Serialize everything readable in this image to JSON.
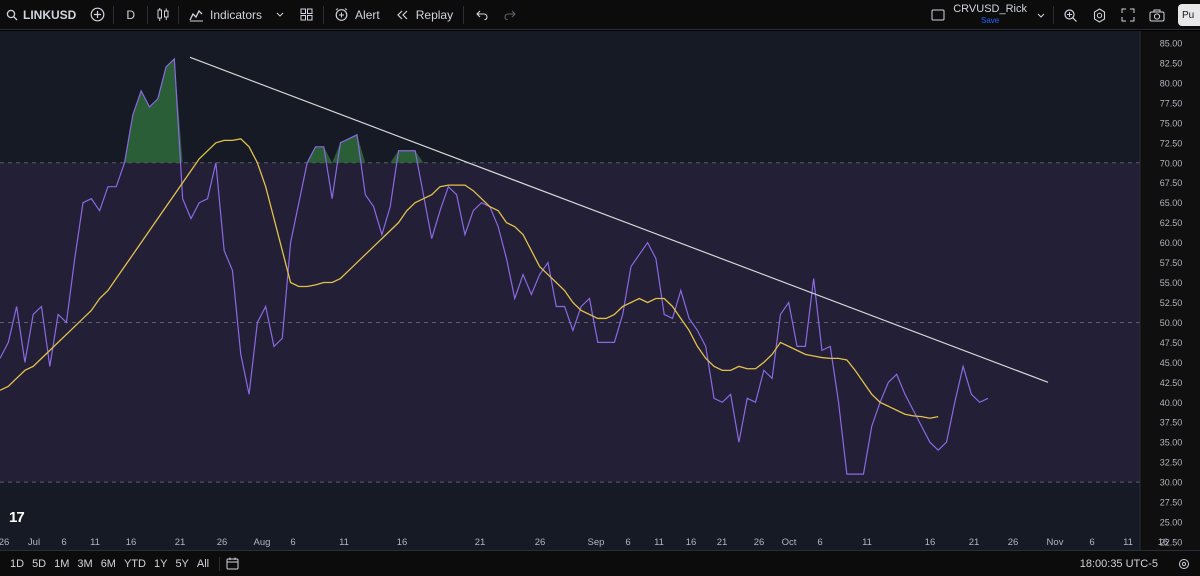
{
  "toolbar": {
    "symbol": "LINKUSD",
    "interval": "D",
    "indicators_label": "Indicators",
    "alert_label": "Alert",
    "replay_label": "Replay",
    "layout_name": "CRVUSD_Rick",
    "save_label": "Save",
    "publish_label": "Pu"
  },
  "bottom": {
    "ranges": [
      "1D",
      "5D",
      "1M",
      "3M",
      "6M",
      "YTD",
      "1Y",
      "5Y",
      "All"
    ],
    "clock": "18:00:35 UTC-5"
  },
  "chart": {
    "logo": "17",
    "price_axis_labels": [
      "85.00",
      "82.50",
      "80.00",
      "77.50",
      "75.00",
      "72.50",
      "70.00",
      "67.50",
      "65.00",
      "62.50",
      "60.00",
      "57.50",
      "55.00",
      "52.50",
      "50.00",
      "47.50",
      "45.00",
      "42.50",
      "40.00",
      "37.50",
      "35.00",
      "32.50",
      "30.00",
      "27.50",
      "25.00",
      "22.50"
    ],
    "time_axis": [
      {
        "label": "26",
        "x": 4
      },
      {
        "label": "Jul",
        "x": 34
      },
      {
        "label": "6",
        "x": 64
      },
      {
        "label": "11",
        "x": 95
      },
      {
        "label": "16",
        "x": 131
      },
      {
        "label": "21",
        "x": 180
      },
      {
        "label": "26",
        "x": 222
      },
      {
        "label": "Aug",
        "x": 262
      },
      {
        "label": "6",
        "x": 293
      },
      {
        "label": "11",
        "x": 344
      },
      {
        "label": "16",
        "x": 402
      },
      {
        "label": "21",
        "x": 480
      },
      {
        "label": "26",
        "x": 540
      },
      {
        "label": "Sep",
        "x": 596
      },
      {
        "label": "6",
        "x": 628
      },
      {
        "label": "11",
        "x": 659
      },
      {
        "label": "16",
        "x": 691
      },
      {
        "label": "21",
        "x": 722
      },
      {
        "label": "26",
        "x": 759
      },
      {
        "label": "Oct",
        "x": 789
      },
      {
        "label": "6",
        "x": 820
      },
      {
        "label": "11",
        "x": 867
      },
      {
        "label": "16",
        "x": 930
      },
      {
        "label": "21",
        "x": 974
      },
      {
        "label": "26",
        "x": 1013
      },
      {
        "label": "Nov",
        "x": 1055
      },
      {
        "label": "6",
        "x": 1092
      },
      {
        "label": "11",
        "x": 1128
      },
      {
        "label": "16",
        "x": 1163
      }
    ],
    "colors": {
      "background": "#161a25",
      "band": "#221f37",
      "rsi": "#8a6ae0",
      "ma": "#e2c14a",
      "trendline": "#d6d6d6",
      "overbought_fill": "#2e6b3a"
    }
  },
  "chart_data": {
    "type": "line",
    "title": "",
    "y_range": [
      21.5,
      87
    ],
    "levels": {
      "upper": 70,
      "middle": 50,
      "lower": 30
    },
    "series": [
      {
        "values": [
          45.5,
          47.5,
          52,
          45,
          51,
          52,
          44.5,
          51,
          50,
          58,
          65,
          65.5,
          64,
          67,
          67,
          70,
          76,
          79,
          77,
          78,
          82,
          83,
          65.5,
          63,
          65,
          65.5,
          70,
          59,
          56.5,
          46,
          41,
          50,
          52,
          47,
          48,
          60,
          65,
          70,
          72,
          72,
          65.5,
          72.5,
          73,
          73.5,
          66,
          64.5,
          61,
          64.5,
          71.5,
          71.5,
          71.5,
          66,
          60.5,
          64,
          67,
          66,
          61,
          64,
          65,
          64.5,
          62,
          58,
          53,
          56,
          53.5,
          56,
          57.5,
          52,
          52,
          49,
          52,
          53,
          47.5,
          47.5,
          47.5,
          51,
          57,
          58.5,
          60,
          58,
          51,
          50.5,
          54,
          50.5,
          49,
          47,
          40.5,
          40,
          41,
          35,
          40.5,
          40,
          44,
          43,
          51,
          52.5,
          47,
          47,
          55.5,
          46.5,
          47,
          40,
          31,
          31,
          31,
          37,
          40,
          42.5,
          43.5,
          41,
          39,
          37,
          35,
          34,
          35,
          40,
          44.5,
          41,
          40,
          40.5
        ]
      },
      {
        "values": [
          41.5,
          42,
          43,
          44,
          44.5,
          45.5,
          46.5,
          47.5,
          48.5,
          49.5,
          50.5,
          51.5,
          53,
          54,
          55.5,
          57,
          58.5,
          60,
          61.5,
          63,
          64.5,
          66,
          67.5,
          69,
          70.5,
          71.5,
          72.5,
          72.8,
          72.8,
          73,
          72,
          70,
          67,
          63,
          59,
          55,
          54.5,
          54.5,
          54.7,
          55,
          55,
          55.5,
          56.5,
          57.5,
          58.5,
          59.5,
          60.5,
          61.5,
          62.5,
          64,
          65,
          65.5,
          66,
          67,
          67.2,
          67.2,
          67.2,
          66.5,
          65.5,
          64.5,
          64,
          62.5,
          62,
          61,
          59,
          57,
          56,
          55,
          54,
          52.5,
          51.5,
          51,
          50.5,
          50.5,
          51,
          52,
          52.5,
          53,
          52.5,
          53,
          53,
          52,
          50.5,
          49,
          47,
          45.5,
          44.5,
          44,
          44,
          44.5,
          44.2,
          44.2,
          45,
          46,
          47.5,
          47,
          46.5,
          46,
          45.8,
          45.6,
          45.5,
          45.5,
          45.3,
          44,
          42.5,
          41,
          40,
          39.5,
          39,
          38.5,
          38.3,
          38.2,
          38,
          38.2
        ]
      }
    ],
    "trendline": {
      "from": {
        "date": "Jul 22",
        "value": 83.2
      },
      "to": {
        "date": "Oct 31",
        "value": 42.5
      }
    },
    "xlabels": [
      "26",
      "Jul",
      "6",
      "11",
      "16",
      "21",
      "26",
      "Aug",
      "6",
      "11",
      "16",
      "21",
      "26",
      "Sep",
      "6",
      "11",
      "16",
      "21",
      "26",
      "Oct",
      "6",
      "11",
      "16",
      "21",
      "26",
      "Nov",
      "6",
      "11",
      "16"
    ],
    "ylabels": [
      "85.00",
      "82.50",
      "80.00",
      "77.50",
      "75.00",
      "72.50",
      "70.00",
      "67.50",
      "65.00",
      "62.50",
      "60.00",
      "57.50",
      "55.00",
      "52.50",
      "50.00",
      "47.50",
      "45.00",
      "42.50",
      "40.00",
      "37.50",
      "35.00",
      "32.50",
      "30.00",
      "27.50",
      "25.00",
      "22.50"
    ]
  }
}
